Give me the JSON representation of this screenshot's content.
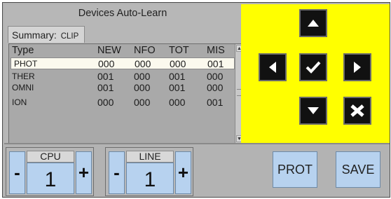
{
  "panel": {
    "title": "Devices Auto-Learn",
    "summary_label": "Summary:",
    "summary_value": "CLIP"
  },
  "table": {
    "columns": [
      "Type",
      "NEW",
      "NFO",
      "TOT",
      "MIS"
    ],
    "rows": [
      {
        "type": "PHOT",
        "new": "000",
        "nfo": "000",
        "tot": "000",
        "mis": "001",
        "selected": true
      },
      {
        "type": "THER",
        "new": "001",
        "nfo": "000",
        "tot": "001",
        "mis": "000",
        "selected": false
      },
      {
        "type": "OMNI",
        "new": "001",
        "nfo": "000",
        "tot": "001",
        "mis": "000",
        "selected": false
      },
      {
        "type": "ION",
        "new": "000",
        "nfo": "000",
        "tot": "000",
        "mis": "001",
        "selected": false
      }
    ]
  },
  "nav": {
    "accent_color": "#ffff00",
    "buttons": [
      "up-arrow-icon",
      "left-arrow-icon",
      "check-icon",
      "right-arrow-icon",
      "down-arrow-icon",
      "cancel-x-icon"
    ]
  },
  "cpu": {
    "label": "CPU",
    "value": "1",
    "minus": "-",
    "plus": "+"
  },
  "line": {
    "label": "LINE",
    "value": "1",
    "minus": "-",
    "plus": "+"
  },
  "actions": {
    "prot": "PROT",
    "save": "SAVE"
  }
}
